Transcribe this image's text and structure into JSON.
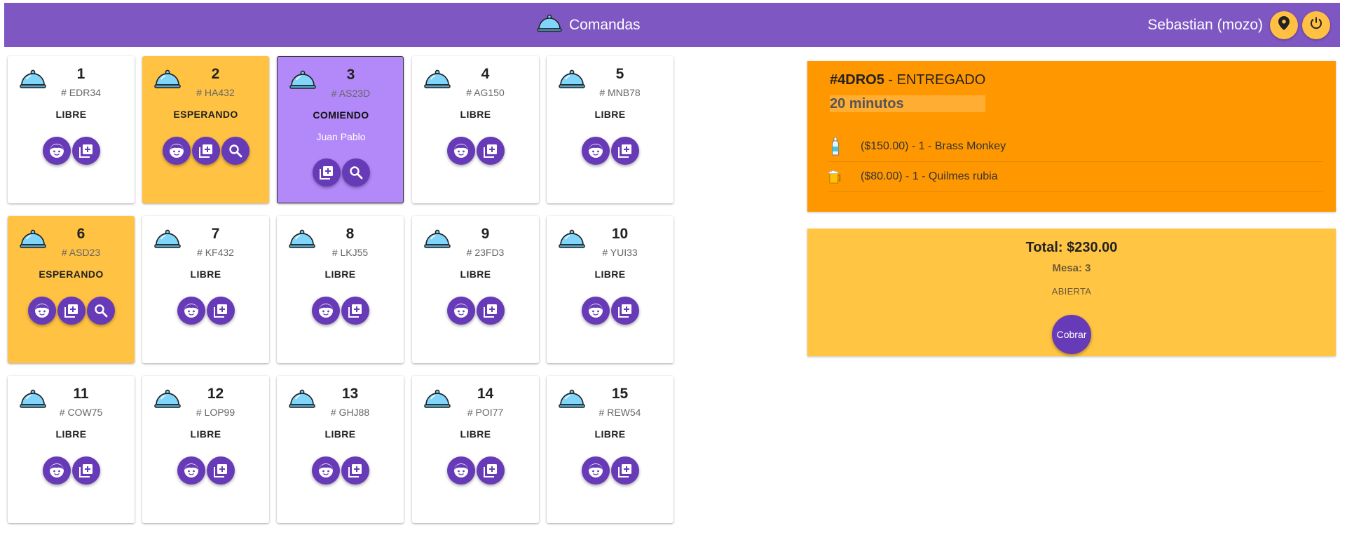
{
  "header": {
    "title": "Comandas",
    "user": "Sebastian (mozo)",
    "icons": [
      "cloche-icon",
      "location-pin-icon",
      "power-icon"
    ],
    "color": "#7e57c2",
    "button_color": "#ffc043"
  },
  "tables": [
    {
      "number": "1",
      "code": "# EDR34",
      "status": "LIBRE",
      "person": "",
      "actions": [
        "face",
        "add"
      ]
    },
    {
      "number": "2",
      "code": "# HA432",
      "status": "ESPERANDO",
      "person": "",
      "actions": [
        "face",
        "add",
        "search"
      ]
    },
    {
      "number": "3",
      "code": "# AS23D",
      "status": "COMIENDO",
      "person": "Juan Pablo",
      "actions": [
        "add",
        "search"
      ]
    },
    {
      "number": "4",
      "code": "# AG150",
      "status": "LIBRE",
      "person": "",
      "actions": [
        "face",
        "add"
      ]
    },
    {
      "number": "5",
      "code": "# MNB78",
      "status": "LIBRE",
      "person": "",
      "actions": [
        "face",
        "add"
      ]
    },
    {
      "number": "6",
      "code": "# ASD23",
      "status": "ESPERANDO",
      "person": "",
      "actions": [
        "face",
        "add",
        "search"
      ]
    },
    {
      "number": "7",
      "code": "# KF432",
      "status": "LIBRE",
      "person": "",
      "actions": [
        "face",
        "add"
      ]
    },
    {
      "number": "8",
      "code": "# LKJ55",
      "status": "LIBRE",
      "person": "",
      "actions": [
        "face",
        "add"
      ]
    },
    {
      "number": "9",
      "code": "# 23FD3",
      "status": "LIBRE",
      "person": "",
      "actions": [
        "face",
        "add"
      ]
    },
    {
      "number": "10",
      "code": "# YUI33",
      "status": "LIBRE",
      "person": "",
      "actions": [
        "face",
        "add"
      ]
    },
    {
      "number": "11",
      "code": "# COW75",
      "status": "LIBRE",
      "person": "",
      "actions": [
        "face",
        "add"
      ]
    },
    {
      "number": "12",
      "code": "# LOP99",
      "status": "LIBRE",
      "person": "",
      "actions": [
        "face",
        "add"
      ]
    },
    {
      "number": "13",
      "code": "# GHJ88",
      "status": "LIBRE",
      "person": "",
      "actions": [
        "face",
        "add"
      ]
    },
    {
      "number": "14",
      "code": "# POI77",
      "status": "LIBRE",
      "person": "",
      "actions": [
        "face",
        "add"
      ]
    },
    {
      "number": "15",
      "code": "# REW54",
      "status": "LIBRE",
      "person": "",
      "actions": [
        "face",
        "add"
      ]
    }
  ],
  "order": {
    "id": "#4DRO5",
    "separator": " - ",
    "status": "ENTREGADO",
    "time": "20 minutos",
    "items": [
      {
        "icon": "bottle-icon",
        "text": "($150.00) - 1 - Brass Monkey"
      },
      {
        "icon": "beer-mug-icon",
        "text": "($80.00) - 1 - Quilmes rubia"
      }
    ],
    "color": "#ff9800"
  },
  "summary": {
    "total": "Total: $230.00",
    "mesa": "Mesa: 3",
    "status": "ABIERTA",
    "pay_button": "Cobrar",
    "color": "#ffc543"
  },
  "colors": {
    "libre": "#ffffff",
    "esperando": "#ffc243",
    "comiendo": "#b388f8",
    "fab": "#673ab7",
    "tray": "#81d4fa"
  }
}
